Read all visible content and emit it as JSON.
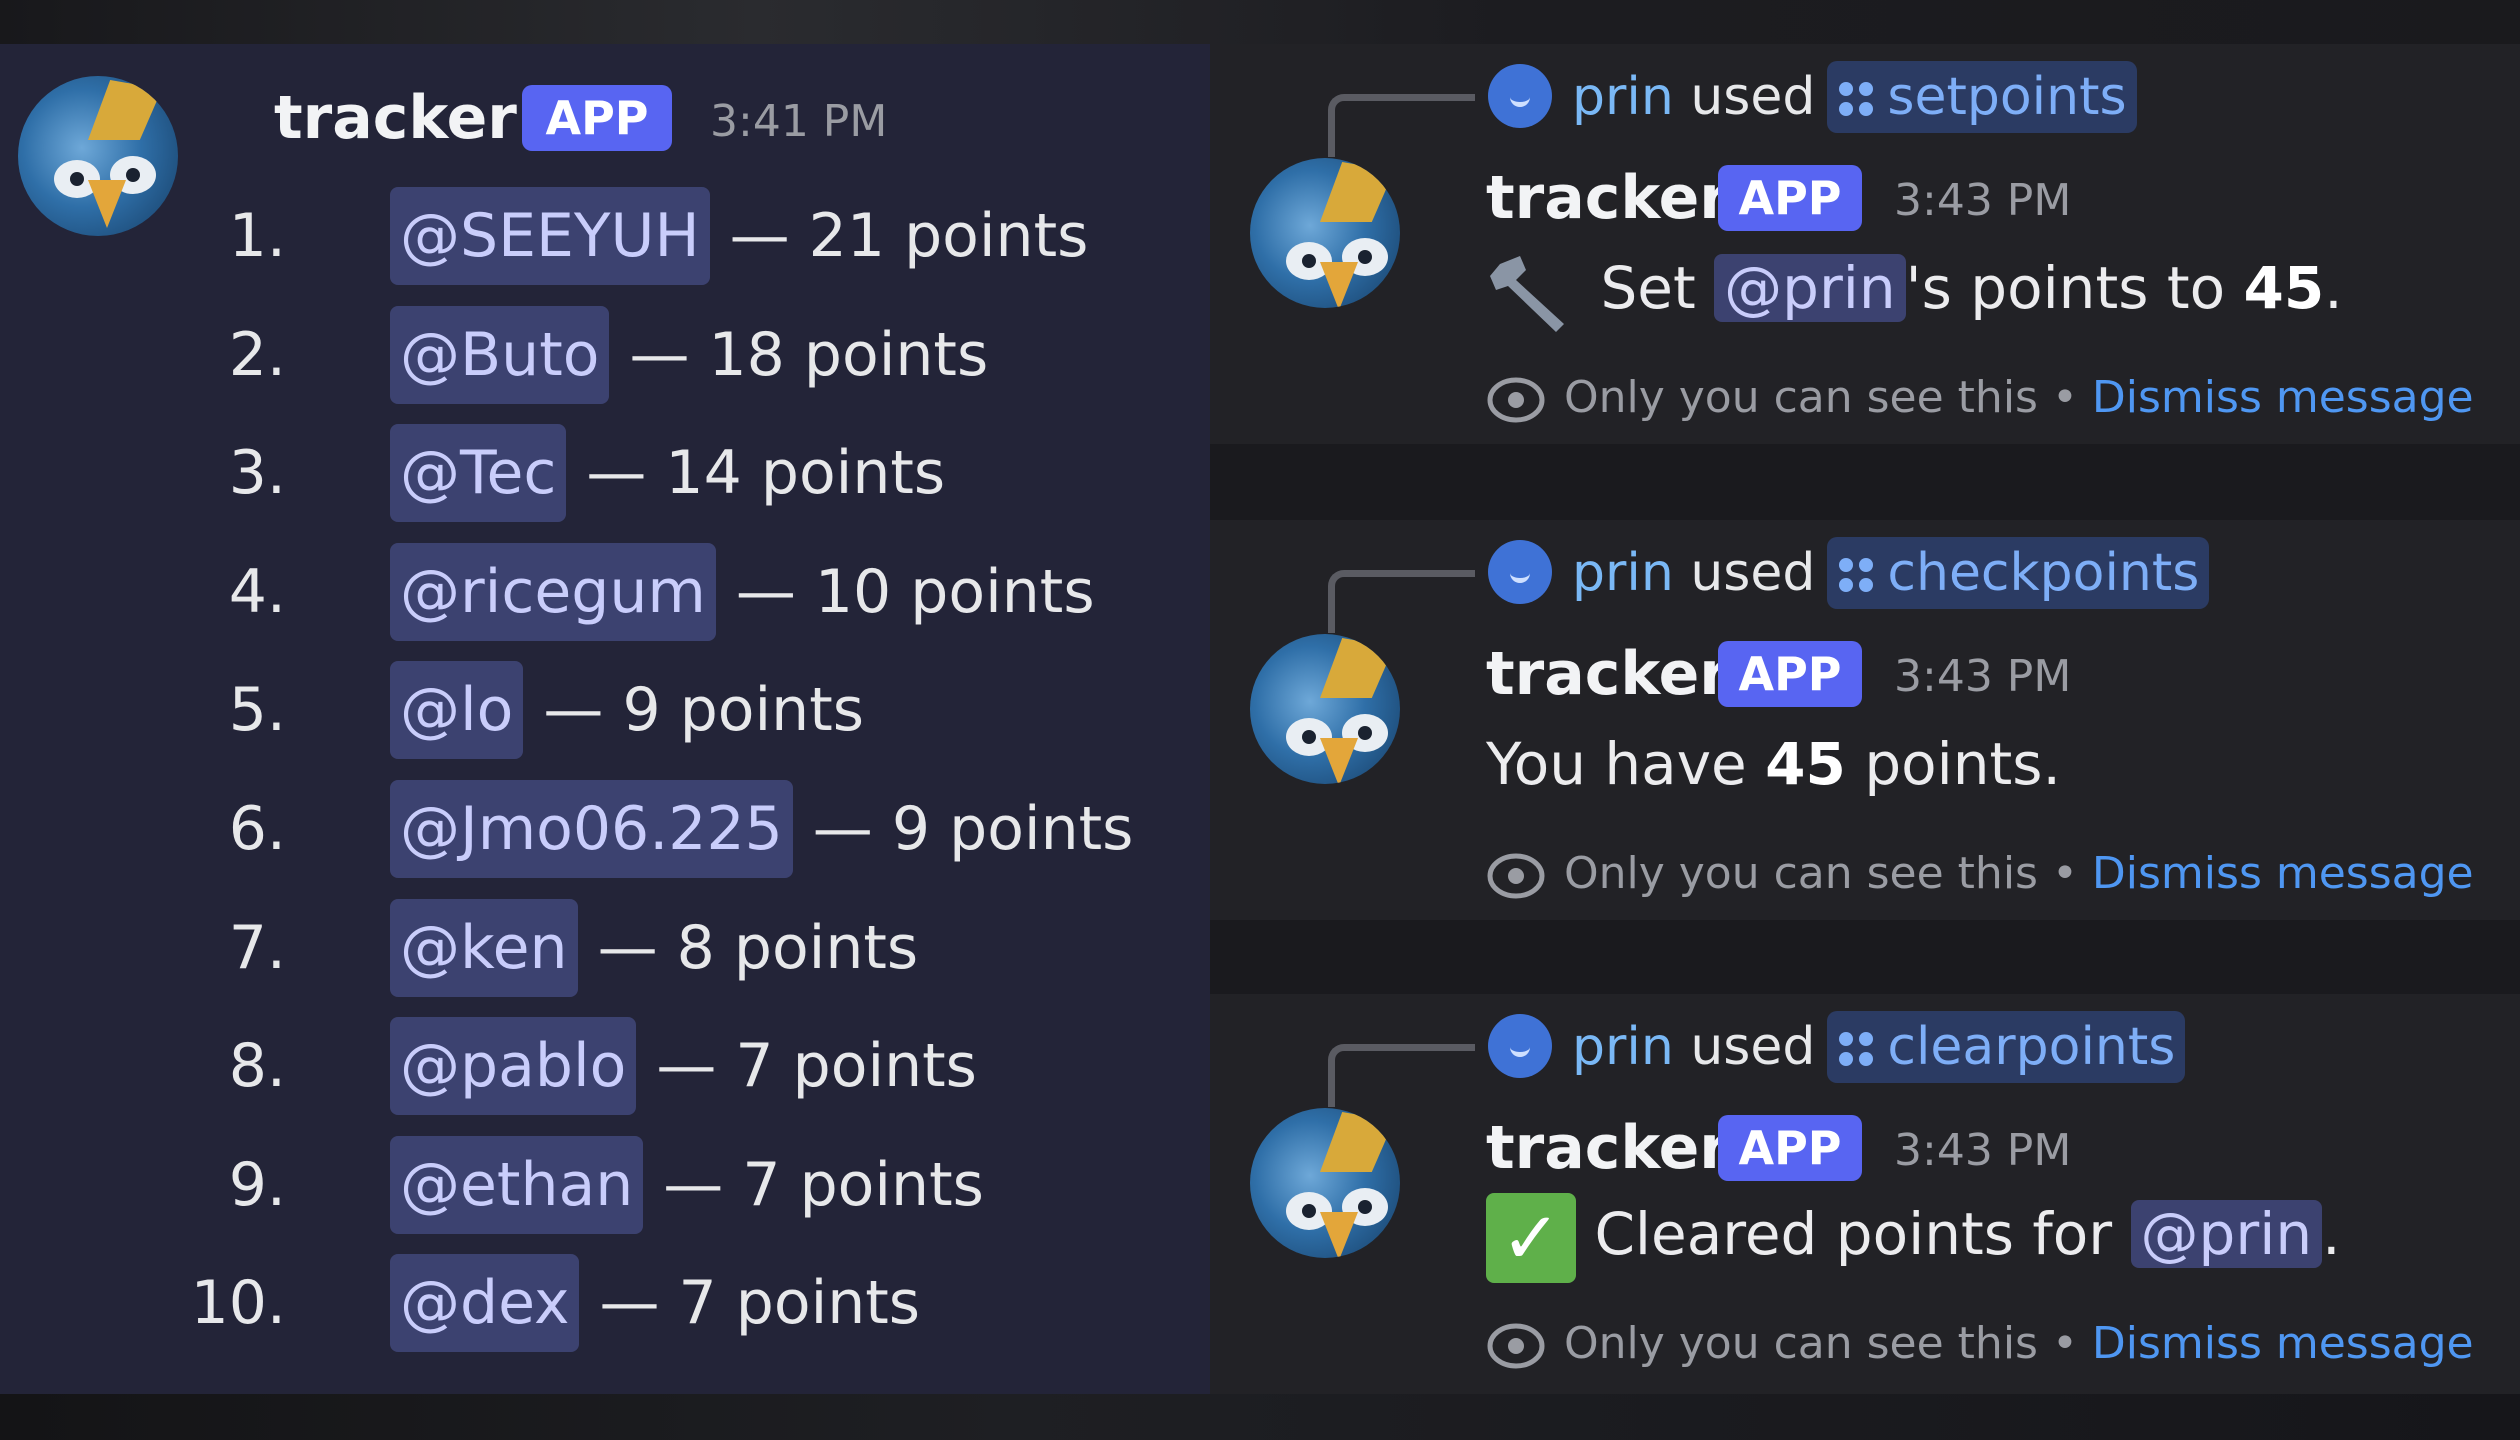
{
  "leaderboard_message": {
    "username": "tracker",
    "badge": "APP",
    "timestamp": "3:41 PM",
    "entries": [
      {
        "rank": "1.",
        "user": "@SEEYUH",
        "points": "— 21 points"
      },
      {
        "rank": "2.",
        "user": "@Buto",
        "points": "— 18 points"
      },
      {
        "rank": "3.",
        "user": "@Tec",
        "points": "— 14 points"
      },
      {
        "rank": "4.",
        "user": "@ricegum",
        "points": "— 10 points"
      },
      {
        "rank": "5.",
        "user": "@lo",
        "points": "— 9 points"
      },
      {
        "rank": "6.",
        "user": "@Jmo06.225",
        "points": "— 9 points"
      },
      {
        "rank": "7.",
        "user": "@ken",
        "points": "— 8 points"
      },
      {
        "rank": "8.",
        "user": "@pablo",
        "points": "— 7 points"
      },
      {
        "rank": "9.",
        "user": "@ethan",
        "points": "— 7 points"
      },
      {
        "rank": "10.",
        "user": "@dex",
        "points": "— 7 points"
      }
    ]
  },
  "messages": [
    {
      "reply_user": "prin",
      "reply_used": "used",
      "command": "setpoints",
      "username": "tracker",
      "badge": "APP",
      "timestamp": "3:43 PM",
      "icon": "wrench-icon",
      "text_before": "Set",
      "mention": "@prin",
      "text_after": "'s points to",
      "bold": "45",
      "end": ".",
      "ephemeral": "Only you can see this •",
      "dismiss": "Dismiss message"
    },
    {
      "reply_user": "prin",
      "reply_used": "used",
      "command": "checkpoints",
      "username": "tracker",
      "badge": "APP",
      "timestamp": "3:43 PM",
      "text_before": "You have",
      "bold": "45",
      "text_after": "points.",
      "ephemeral": "Only you can see this •",
      "dismiss": "Dismiss message"
    },
    {
      "reply_user": "prin",
      "reply_used": "used",
      "command": "clearpoints",
      "username": "tracker",
      "badge": "APP",
      "timestamp": "3:43 PM",
      "icon": "check-mark-icon",
      "text_before": "Cleared points for",
      "mention": "@prin",
      "end": ".",
      "ephemeral": "Only you can see this •",
      "dismiss": "Dismiss message"
    }
  ],
  "colors": {
    "mention_bg": "#3c4270",
    "mention_text": "#c9cdfb",
    "app_badge": "#5865f2",
    "link": "#4f97f2",
    "reply_name": "#7ab8f5"
  }
}
